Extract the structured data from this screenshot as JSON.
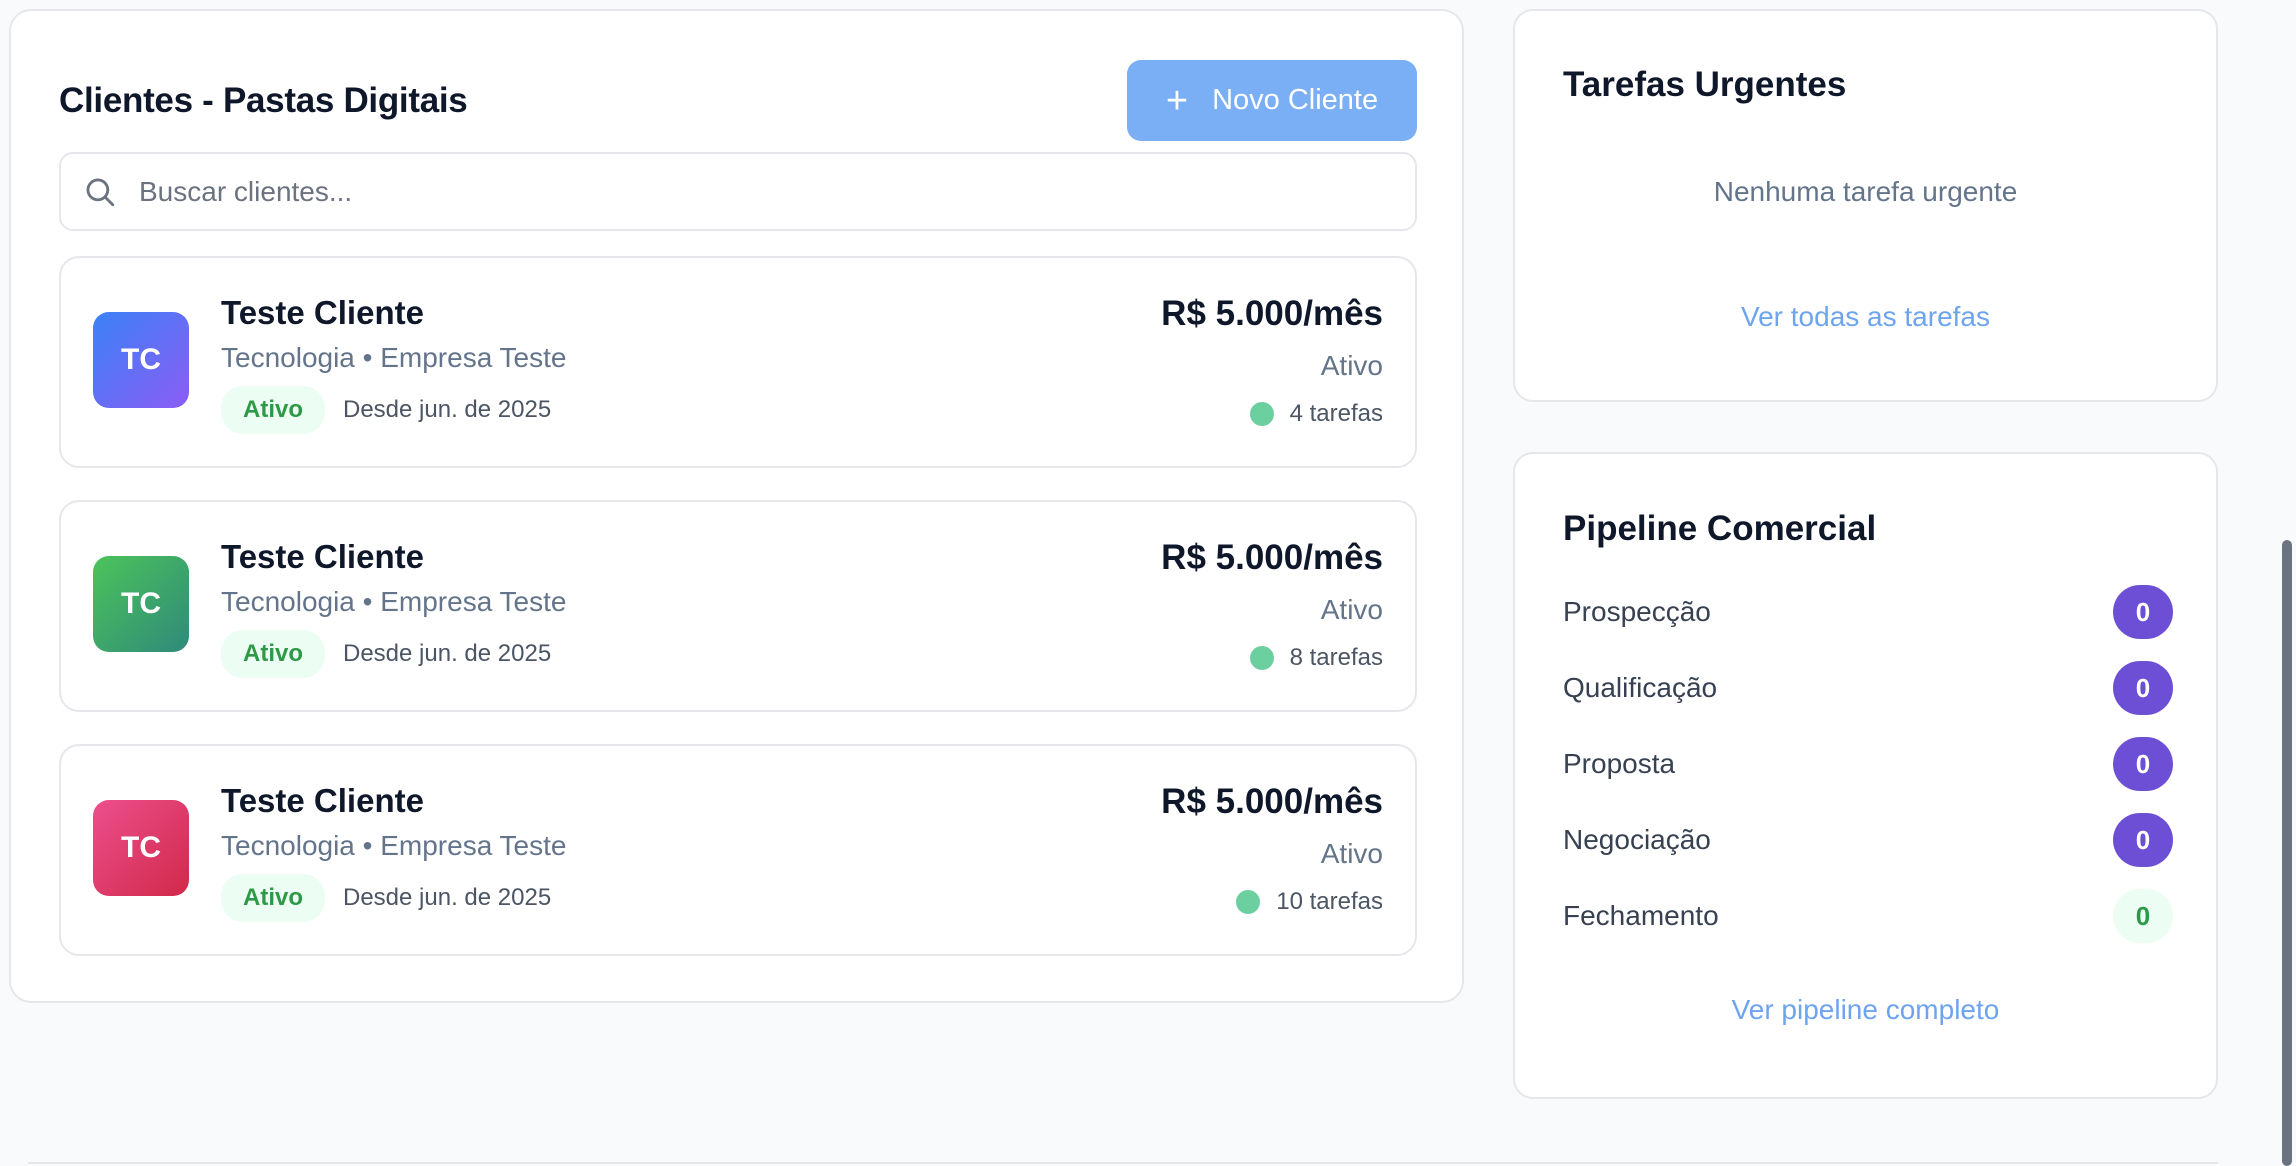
{
  "clients_section": {
    "title": "Clientes - Pastas Digitais",
    "new_client_label": "Novo Cliente",
    "search_placeholder": "Buscar clientes...",
    "clients": [
      {
        "initials": "TC",
        "name": "Teste Cliente",
        "subtitle": "Tecnologia • Empresa Teste",
        "status_badge": "Ativo",
        "since": "Desde jun. de 2025",
        "price": "R$ 5.000/mês",
        "status": "Ativo",
        "tasks": "4 tarefas",
        "avatar_gradient": [
          "#3b82f6",
          "#8b5cf6"
        ]
      },
      {
        "initials": "TC",
        "name": "Teste Cliente",
        "subtitle": "Tecnologia • Empresa Teste",
        "status_badge": "Ativo",
        "since": "Desde jun. de 2025",
        "price": "R$ 5.000/mês",
        "status": "Ativo",
        "tasks": "8 tarefas",
        "avatar_gradient": [
          "#4cc35a",
          "#2f8a7a"
        ]
      },
      {
        "initials": "TC",
        "name": "Teste Cliente",
        "subtitle": "Tecnologia • Empresa Teste",
        "status_badge": "Ativo",
        "since": "Desde jun. de 2025",
        "price": "R$ 5.000/mês",
        "status": "Ativo",
        "tasks": "10 tarefas",
        "avatar_gradient": [
          "#ec4f8c",
          "#d1294b"
        ]
      }
    ]
  },
  "urgent_tasks": {
    "title": "Tarefas Urgentes",
    "empty_text": "Nenhuma tarefa urgente",
    "link_label": "Ver todas as tarefas"
  },
  "pipeline": {
    "title": "Pipeline Comercial",
    "stages": [
      {
        "label": "Prospecção",
        "count": "0"
      },
      {
        "label": "Qualificação",
        "count": "0"
      },
      {
        "label": "Proposta",
        "count": "0"
      },
      {
        "label": "Negociação",
        "count": "0"
      },
      {
        "label": "Fechamento",
        "count": "0"
      }
    ],
    "link_label": "Ver pipeline completo"
  },
  "colors": {
    "primary_button": "#7aaef5",
    "link": "#6ea4ef",
    "pipeline_badge": "#6d4fd6",
    "success": "#2e9a48",
    "task_dot": "#6ccf9f"
  },
  "icons": [
    "plus-icon",
    "search-icon"
  ]
}
